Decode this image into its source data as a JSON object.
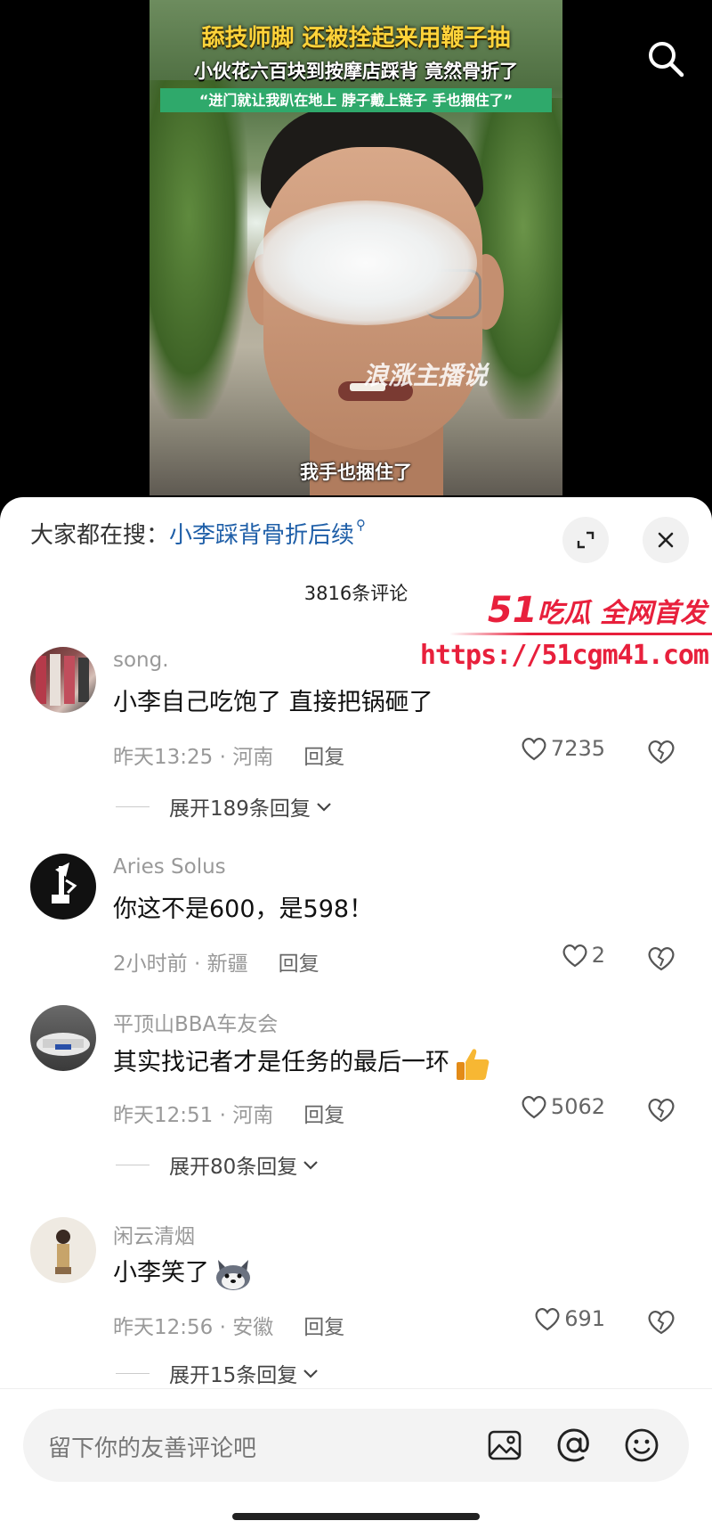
{
  "video": {
    "headline": "舔技师脚 还被拴起来用鞭子抽",
    "subline": "小伙花六百块到按摩店踩背 竟然骨折了",
    "quote": "“进门就让我趴在地上 脖子戴上链子 手也捆住了”",
    "watermark": "浪涨主播说",
    "caption": "我手也捆住了"
  },
  "sheet": {
    "search_label": "大家都在搜：",
    "search_term": "小李踩背骨折后续",
    "comment_count": "3816条评论"
  },
  "promo": {
    "brand_num": "51",
    "brand_text": "吃瓜 全网首发",
    "url": "https://51cgm41.com"
  },
  "comments": [
    {
      "user": "song.",
      "text": "小李自己吃饱了  直接把锅砸了",
      "time": "昨天13:25",
      "location": "河南",
      "reply": "回复",
      "likes": "7235",
      "expand": "展开189条回复"
    },
    {
      "user": "Aries Solus",
      "text": "你这不是600，是598！",
      "time": "2小时前",
      "location": "新疆",
      "reply": "回复",
      "likes": "2"
    },
    {
      "user": "平顶山BBA车友会",
      "text": "其实找记者才是任务的最后一环",
      "time": "昨天12:51",
      "location": "河南",
      "reply": "回复",
      "likes": "5062",
      "expand": "展开80条回复"
    },
    {
      "user": "闲云清烟",
      "text": "小李笑了",
      "time": "昨天12:56",
      "location": "安徽",
      "reply": "回复",
      "likes": "691",
      "expand": "展开15条回复"
    }
  ],
  "input": {
    "placeholder": "留下你的友善评论吧"
  },
  "icons": {
    "search": "search-icon",
    "expand": "expand-icon",
    "close": "close-icon",
    "like": "heart-icon",
    "dislike": "broken-heart-icon",
    "image": "image-icon",
    "mention": "at-icon",
    "emoji": "smiley-icon"
  },
  "colors": {
    "accent_link": "#1f5fa8",
    "promo_red": "#e8203c",
    "headline_yellow": "#ffd33a",
    "quote_green": "#2fa96b"
  }
}
